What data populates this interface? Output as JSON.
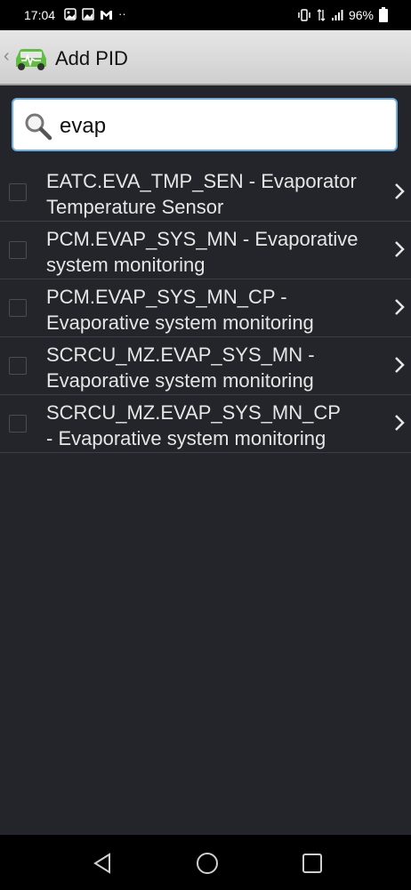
{
  "status_bar": {
    "time": "17:04",
    "notif_icons": [
      "photo-icon",
      "gallery-icon",
      "gmail-icon",
      "more-notifications-icon"
    ],
    "battery": "96%"
  },
  "app_bar": {
    "title": "Add PID"
  },
  "search": {
    "value": "evap"
  },
  "pids": [
    {
      "label": "EATC.EVA_TMP_SEN - Evaporator\nTemperature Sensor"
    },
    {
      "label": "PCM.EVAP_SYS_MN - Evaporative\nsystem monitoring"
    },
    {
      "label": "PCM.EVAP_SYS_MN_CP -\nEvaporative system monitoring"
    },
    {
      "label": "SCRCU_MZ.EVAP_SYS_MN -\nEvaporative system monitoring"
    },
    {
      "label": "SCRCU_MZ.EVAP_SYS_MN_CP\n- Evaporative system monitoring"
    }
  ],
  "colors": {
    "background": "#24252b",
    "app_bar": "#dcdcdc",
    "search_border": "#6fb0e0",
    "text": "#e6e6e6",
    "accent_green": "#5fbf3f"
  }
}
